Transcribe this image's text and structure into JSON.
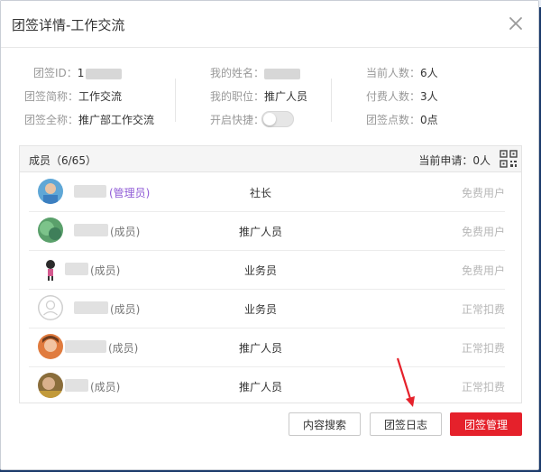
{
  "dialog": {
    "title": "团签详情-工作交流",
    "close_icon": "close-icon"
  },
  "info": {
    "col1": [
      {
        "label": "团签ID：",
        "value": "1"
      },
      {
        "label": "团签简称：",
        "value": "工作交流"
      },
      {
        "label": "团签全称：",
        "value": "推广部工作交流"
      }
    ],
    "col2": [
      {
        "label": "我的姓名：",
        "value": ""
      },
      {
        "label": "我的职位：",
        "value": "推广人员"
      },
      {
        "label": "开启快捷：",
        "value": ""
      }
    ],
    "col3": [
      {
        "label": "当前人数：",
        "value": "6人"
      },
      {
        "label": "付费人数：",
        "value": "3人"
      },
      {
        "label": "团签点数：",
        "value": "0点"
      }
    ]
  },
  "members": {
    "title": "成员（6/65）",
    "apply_label": "当前申请：",
    "apply_count": "0人",
    "qr_icon": "qr-code-icon",
    "rows": [
      {
        "role": "(管理员)",
        "post": "社长",
        "status": "免费用户"
      },
      {
        "role": "(成员)",
        "post": "推广人员",
        "status": "免费用户"
      },
      {
        "role": "(成员)",
        "post": "业务员",
        "status": "免费用户"
      },
      {
        "role": "(成员)",
        "post": "业务员",
        "status": "正常扣费"
      },
      {
        "role": "(成员)",
        "post": "推广人员",
        "status": "正常扣费"
      },
      {
        "role": "(成员)",
        "post": "推广人员",
        "status": "正常扣费"
      }
    ]
  },
  "footer": {
    "search_label": "内容搜索",
    "log_label": "团签日志",
    "manage_label": "团签管理"
  },
  "colors": {
    "primary": "#e5212b",
    "admin_role": "#8f5bd6",
    "annotation_arrow": "#e5212b"
  }
}
